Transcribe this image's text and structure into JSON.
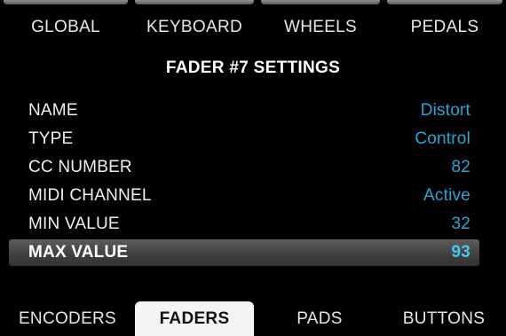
{
  "top_tabs": [
    {
      "label": "GLOBAL"
    },
    {
      "label": "KEYBOARD"
    },
    {
      "label": "WHEELS"
    },
    {
      "label": "PEDALS"
    }
  ],
  "section": {
    "title": "FADER #7 SETTINGS"
  },
  "settings": [
    {
      "label": "NAME",
      "value": "Distort"
    },
    {
      "label": "TYPE",
      "value": "Control"
    },
    {
      "label": "CC NUMBER",
      "value": "82"
    },
    {
      "label": "MIDI CHANNEL",
      "value": "Active"
    },
    {
      "label": "MIN VALUE",
      "value": "32"
    },
    {
      "label": "MAX VALUE",
      "value": "93",
      "selected": true
    }
  ],
  "bottom_tabs": [
    {
      "label": "ENCODERS"
    },
    {
      "label": "FADERS",
      "active": true
    },
    {
      "label": "PADS"
    },
    {
      "label": "BUTTONS"
    }
  ],
  "colors": {
    "background": "#000000",
    "value_accent": "#25a7d8",
    "selected_row": "#4a4a4a",
    "active_tab": "#f4f4f4"
  }
}
